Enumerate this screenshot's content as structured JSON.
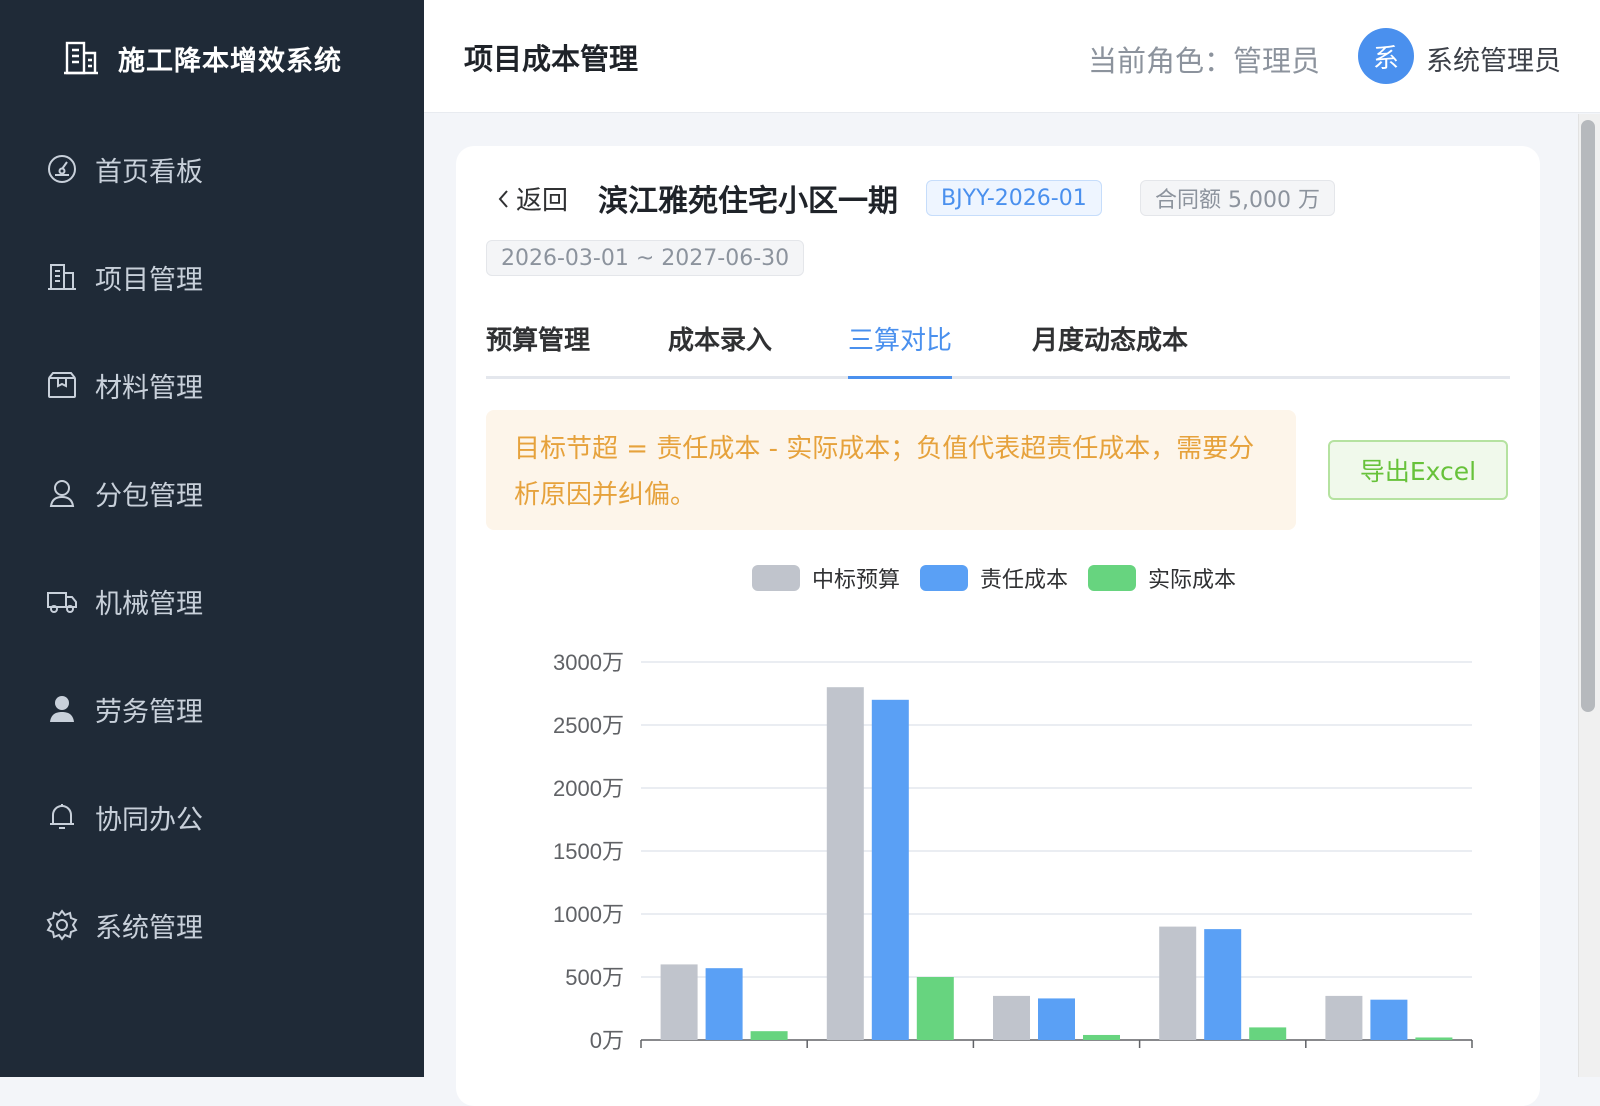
{
  "sidebar": {
    "brand": "施工降本增效系统",
    "items": [
      {
        "label": "首页看板",
        "icon": "dashboard-icon"
      },
      {
        "label": "项目管理",
        "icon": "building-icon"
      },
      {
        "label": "材料管理",
        "icon": "box-icon"
      },
      {
        "label": "分包管理",
        "icon": "user-outline-icon"
      },
      {
        "label": "机械管理",
        "icon": "truck-icon"
      },
      {
        "label": "劳务管理",
        "icon": "user-filled-icon"
      },
      {
        "label": "协同办公",
        "icon": "bell-icon"
      },
      {
        "label": "系统管理",
        "icon": "gear-icon"
      }
    ]
  },
  "header": {
    "title": "项目成本管理",
    "role": "当前角色：管理员",
    "avatar_text": "系",
    "user_name": "系统管理员"
  },
  "project": {
    "back_label": "返回",
    "name": "滨江雅苑住宅小区一期",
    "code": "BJYY-2026-01",
    "amount": "合同额 5,000 万",
    "period": "2026-03-01 ~ 2027-06-30"
  },
  "tabs": [
    "预算管理",
    "成本录入",
    "三算对比",
    "月度动态成本"
  ],
  "active_tab": "三算对比",
  "notice": "目标节超 = 责任成本 - 实际成本；负值代表超责任成本，需要分析原因并纠偏。",
  "export_label": "导出Excel",
  "colors": {
    "sidebar_bg": "#1f2a37",
    "accent": "#4a90ee",
    "series_budget": "#c0c4cc",
    "series_responsibility": "#5aa0f5",
    "series_actual": "#67d47f"
  },
  "chart_data": {
    "type": "bar",
    "categories": [
      "",
      "",
      "",
      "",
      ""
    ],
    "series": [
      {
        "name": "中标预算",
        "values": [
          600,
          2800,
          350,
          900,
          350
        ]
      },
      {
        "name": "责任成本",
        "values": [
          570,
          2700,
          330,
          880,
          320
        ]
      },
      {
        "name": "实际成本",
        "values": [
          70,
          500,
          40,
          100,
          20
        ]
      }
    ],
    "y_ticks": [
      "0万",
      "500万",
      "1000万",
      "1500万",
      "2000万",
      "2500万",
      "3000万"
    ],
    "ylim": [
      0,
      3000
    ],
    "grid": true,
    "legend_position": "top"
  }
}
